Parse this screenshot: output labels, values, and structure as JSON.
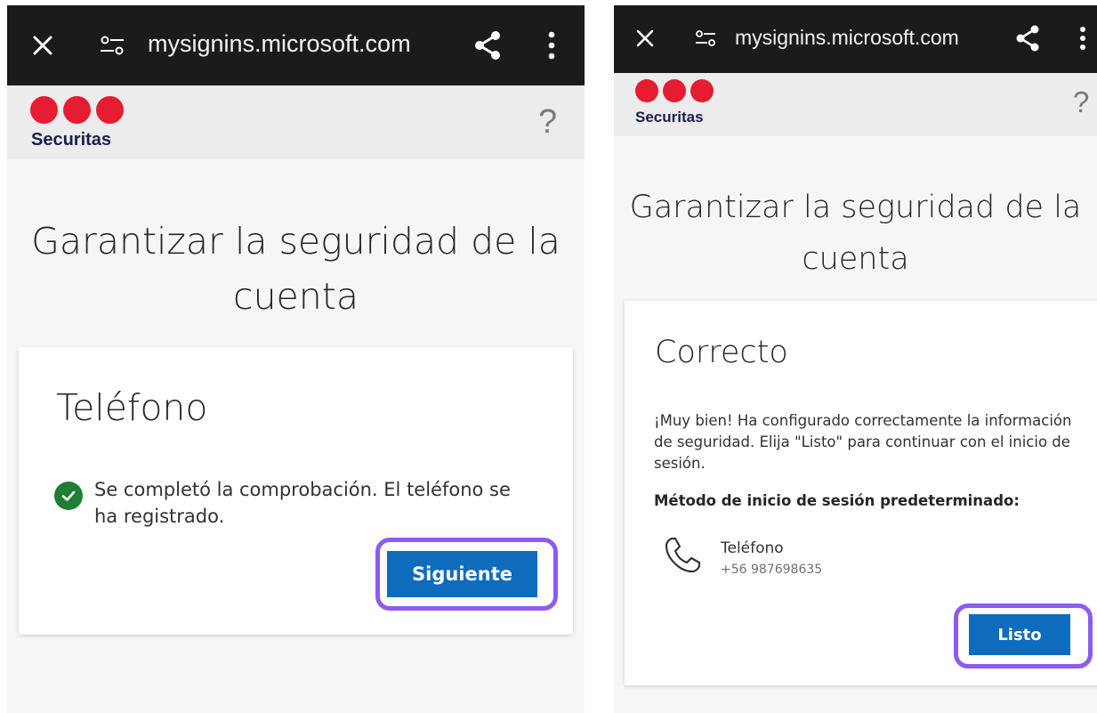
{
  "browser": {
    "url": "mysignins.microsoft.com"
  },
  "brand": {
    "name": "Securitas",
    "help": "?",
    "dot_color": "#e51c32"
  },
  "left": {
    "page_title": "Garantizar la seguridad de la cuenta",
    "card": {
      "title": "Teléfono",
      "message": "Se completó la comprobación. El teléfono se ha registrado.",
      "button": "Siguiente"
    }
  },
  "right": {
    "page_title": "Garantizar la seguridad de la cuenta",
    "card": {
      "title": "Correcto",
      "message": "¡Muy bien! Ha configurado correctamente la información de seguridad. Elija \"Listo\" para continuar con el inicio de sesión.",
      "method_heading": "Método de inicio de sesión predeterminado:",
      "method_name": "Teléfono",
      "method_number": "+56 987698635",
      "button": "Listo"
    }
  },
  "colors": {
    "accent": "#0f6cbd",
    "highlight": "#8c5cf0",
    "success": "#1e7e34"
  }
}
